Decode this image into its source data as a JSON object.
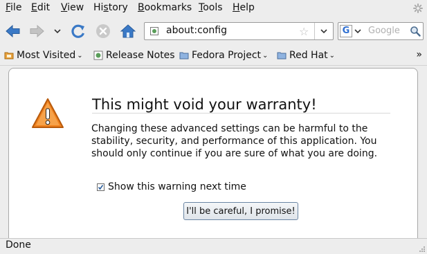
{
  "menu": {
    "file": {
      "u": "F",
      "rest": "ile"
    },
    "edit": {
      "u": "E",
      "rest": "dit"
    },
    "view": {
      "u": "V",
      "rest": "iew"
    },
    "history": {
      "pre": "Hi",
      "u": "s",
      "rest": "tory"
    },
    "bookmarks": {
      "u": "B",
      "rest": "ookmarks"
    },
    "tools": {
      "u": "T",
      "rest": "ools"
    },
    "help": {
      "u": "H",
      "rest": "elp"
    }
  },
  "urlbar": {
    "value": "about:config"
  },
  "search": {
    "placeholder": "Google",
    "engine": "G"
  },
  "bookmarks": {
    "most_visited": "Most Visited",
    "release_notes": "Release Notes",
    "fedora": "Fedora Project",
    "redhat": "Red Hat",
    "overflow": "»"
  },
  "page": {
    "title": "This might void your warranty!",
    "message": "Changing these advanced settings can be harmful to the stability, security, and performance of this application. You should only continue if you are sure of what you are doing.",
    "checkbox_label": "Show this warning next time",
    "checkbox_checked": true,
    "button": "I'll be careful, I promise!"
  },
  "status": {
    "text": "Done"
  },
  "colors": {
    "accent_blue": "#3a79c6",
    "warning_orange": "#f0821e"
  }
}
